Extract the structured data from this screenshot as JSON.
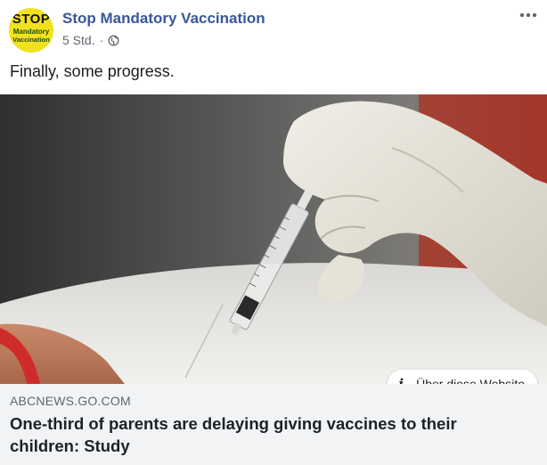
{
  "post": {
    "author": "Stop Mandatory Vaccination",
    "avatar_text": {
      "line1": "STOP",
      "line2": "Mandatory",
      "line3": "Vaccination"
    },
    "time": "5 Std.",
    "separator": "·",
    "privacy_icon": "globe-icon",
    "more_icon": "more-options-icon",
    "text": "Finally, some progress."
  },
  "link_preview": {
    "image_description_icon": "syringe-photo",
    "info_button_label": "Über diese Website",
    "domain": "ABCNEWS.GO.COM",
    "title": "One-third of parents are delaying giving vaccines to their children: Study"
  },
  "colors": {
    "author_link": "#385898",
    "meta_text": "#616770",
    "caption_bg": "#f2f3f5",
    "avatar_bg": "#f2e21d"
  }
}
